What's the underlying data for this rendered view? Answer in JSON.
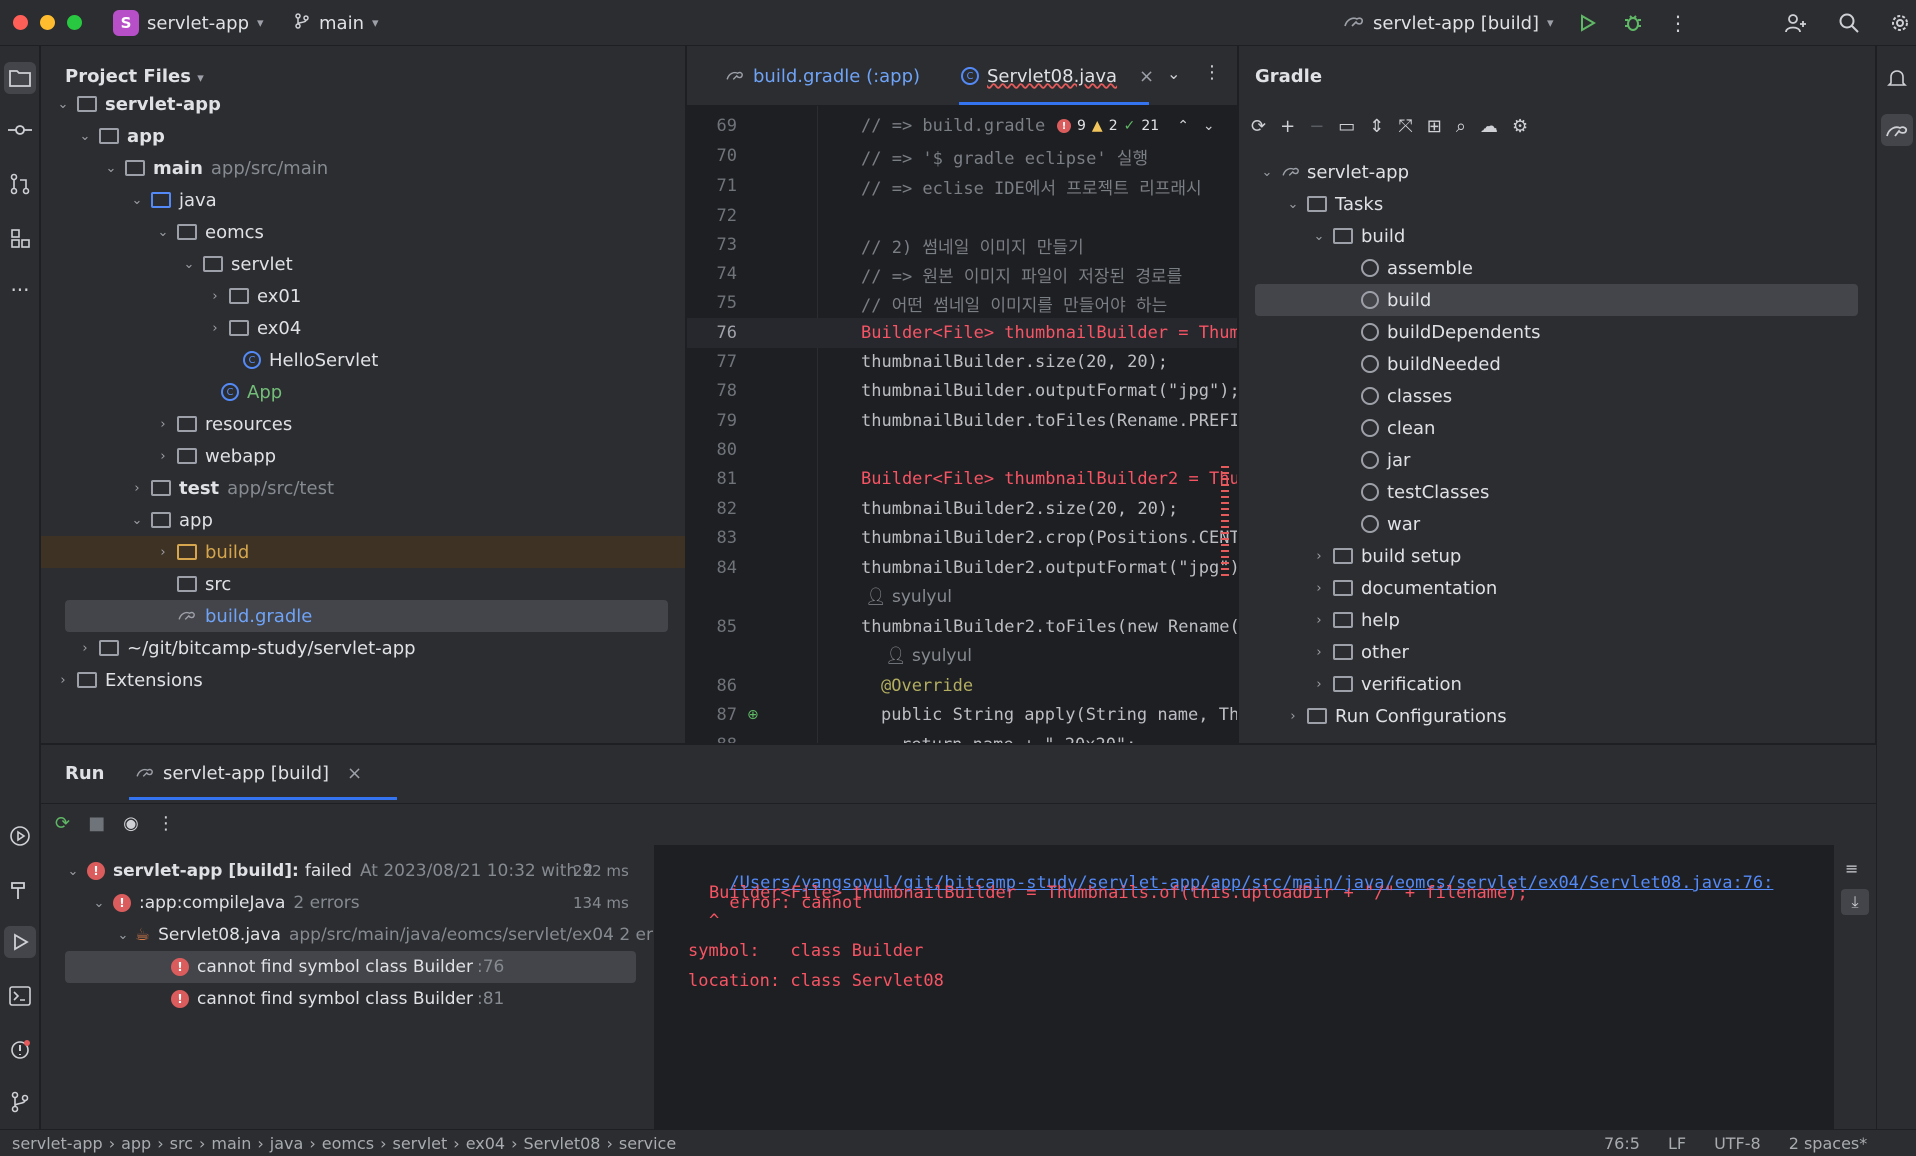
{
  "titlebar": {
    "project_badge": "S",
    "project_name": "servlet-app",
    "branch": "main",
    "run_config": "servlet-app [build]"
  },
  "project": {
    "title": "Project Files",
    "tree": [
      {
        "label": "servlet-app",
        "extra": "",
        "bold": true
      },
      {
        "label": "app",
        "extra": "",
        "bold": true
      },
      {
        "label": "main",
        "extra": "app/src/main",
        "bold": true
      },
      {
        "label": "java",
        "extra": ""
      },
      {
        "label": "eomcs",
        "extra": ""
      },
      {
        "label": "servlet",
        "extra": ""
      },
      {
        "label": "ex01",
        "extra": ""
      },
      {
        "label": "ex04",
        "extra": ""
      },
      {
        "label": "HelloServlet",
        "extra": ""
      },
      {
        "label": "App",
        "extra": ""
      },
      {
        "label": "resources",
        "extra": ""
      },
      {
        "label": "webapp",
        "extra": ""
      },
      {
        "label": "test",
        "extra": "app/src/test",
        "bold": true
      },
      {
        "label": "app",
        "extra": ""
      },
      {
        "label": "build",
        "extra": ""
      },
      {
        "label": "src",
        "extra": ""
      },
      {
        "label": "build.gradle",
        "extra": ""
      },
      {
        "label": "~/git/bitcamp-study/servlet-app",
        "extra": ""
      },
      {
        "label": "Extensions",
        "extra": ""
      }
    ]
  },
  "editor": {
    "tabs": [
      "build.gradle (:app)",
      "Servlet08.java"
    ],
    "inspection": {
      "errors": "9",
      "warnings": "2",
      "ok": "21"
    },
    "lines": [
      {
        "n": "69",
        "text": "// => build.gradle"
      },
      {
        "n": "70",
        "text": "// => '$ gradle eclipse' 실행"
      },
      {
        "n": "71",
        "text": "// => eclise IDE에서 프로젝트 리프래시"
      },
      {
        "n": "72",
        "text": ""
      },
      {
        "n": "73",
        "text": "// 2) 썸네일 이미지 만들기"
      },
      {
        "n": "74",
        "text": "// => 원본 이미지 파일이 저장된 경로를"
      },
      {
        "n": "75",
        "text": "// 어떤 썸네일 이미지를 만들어야 하는"
      },
      {
        "n": "76",
        "text": "Builder<File> thumbnailBuilder = Thumb"
      },
      {
        "n": "77",
        "text": "thumbnailBuilder.size(20, 20);"
      },
      {
        "n": "78",
        "text": "thumbnailBuilder.outputFormat(\"jpg\");"
      },
      {
        "n": "79",
        "text": "thumbnailBuilder.toFiles(Rename.PREFI"
      },
      {
        "n": "80",
        "text": ""
      },
      {
        "n": "81",
        "text": "Builder<File> thumbnailBuilder2 = Thu"
      },
      {
        "n": "82",
        "text": "thumbnailBuilder2.size(20, 20);"
      },
      {
        "n": "83",
        "text": "thumbnailBuilder2.crop(Positions.CENT"
      },
      {
        "n": "84",
        "text": "thumbnailBuilder2.outputFormat(\"jpg\")"
      },
      {
        "n": "",
        "text": "syulyul"
      },
      {
        "n": "85",
        "text": "thumbnailBuilder2.toFiles(new Rename("
      },
      {
        "n": "",
        "text": "syulyul"
      },
      {
        "n": "86",
        "text": "@Override"
      },
      {
        "n": "87",
        "text": "public String apply(String name, Thu"
      },
      {
        "n": "88",
        "text": "  return name + \"_20x20\";"
      }
    ]
  },
  "gradle": {
    "title": "Gradle",
    "tree": [
      {
        "label": "servlet-app"
      },
      {
        "label": "Tasks"
      },
      {
        "label": "build"
      },
      {
        "label": "assemble"
      },
      {
        "label": "build"
      },
      {
        "label": "buildDependents"
      },
      {
        "label": "buildNeeded"
      },
      {
        "label": "classes"
      },
      {
        "label": "clean"
      },
      {
        "label": "jar"
      },
      {
        "label": "testClasses"
      },
      {
        "label": "war"
      },
      {
        "label": "build setup"
      },
      {
        "label": "documentation"
      },
      {
        "label": "help"
      },
      {
        "label": "other"
      },
      {
        "label": "verification"
      },
      {
        "label": "Run Configurations"
      }
    ]
  },
  "run": {
    "title": "Run",
    "tab": "servlet-app [build]",
    "tree": [
      {
        "label": "servlet-app [build]:",
        "status": "failed",
        "extra": "At 2023/08/21 10:32 with 2",
        "time": "292 ms"
      },
      {
        "label": ":app:compileJava",
        "extra": "2 errors",
        "time": "134 ms"
      },
      {
        "label": "Servlet08.java",
        "extra": "app/src/main/java/eomcs/servlet/ex04 2 er"
      },
      {
        "label": "cannot find symbol class Builder",
        "extra": ":76"
      },
      {
        "label": "cannot find symbol class Builder",
        "extra": ":81"
      }
    ],
    "output": {
      "path": "/Users/yangsoyul/git/bitcamp-study/servlet-app/app/src/main/java/eomcs/servlet/ex04/Servlet08.java:76:",
      "error": "error: cannot",
      "line2": "    Builder<File> thumbnailBuilder = Thumbnails.of(this.uploadDir + \"/\" + filename);",
      "line3": "    ^",
      "line4": "symbol:   class Builder",
      "line5": "location: class Servlet08"
    }
  },
  "status": {
    "crumbs": [
      "servlet-app",
      "app",
      "src",
      "main",
      "java",
      "eomcs",
      "servlet",
      "ex04",
      "Servlet08",
      "service"
    ],
    "pos": "76:5",
    "eol": "LF",
    "enc": "UTF-8",
    "indent": "2 spaces*"
  }
}
